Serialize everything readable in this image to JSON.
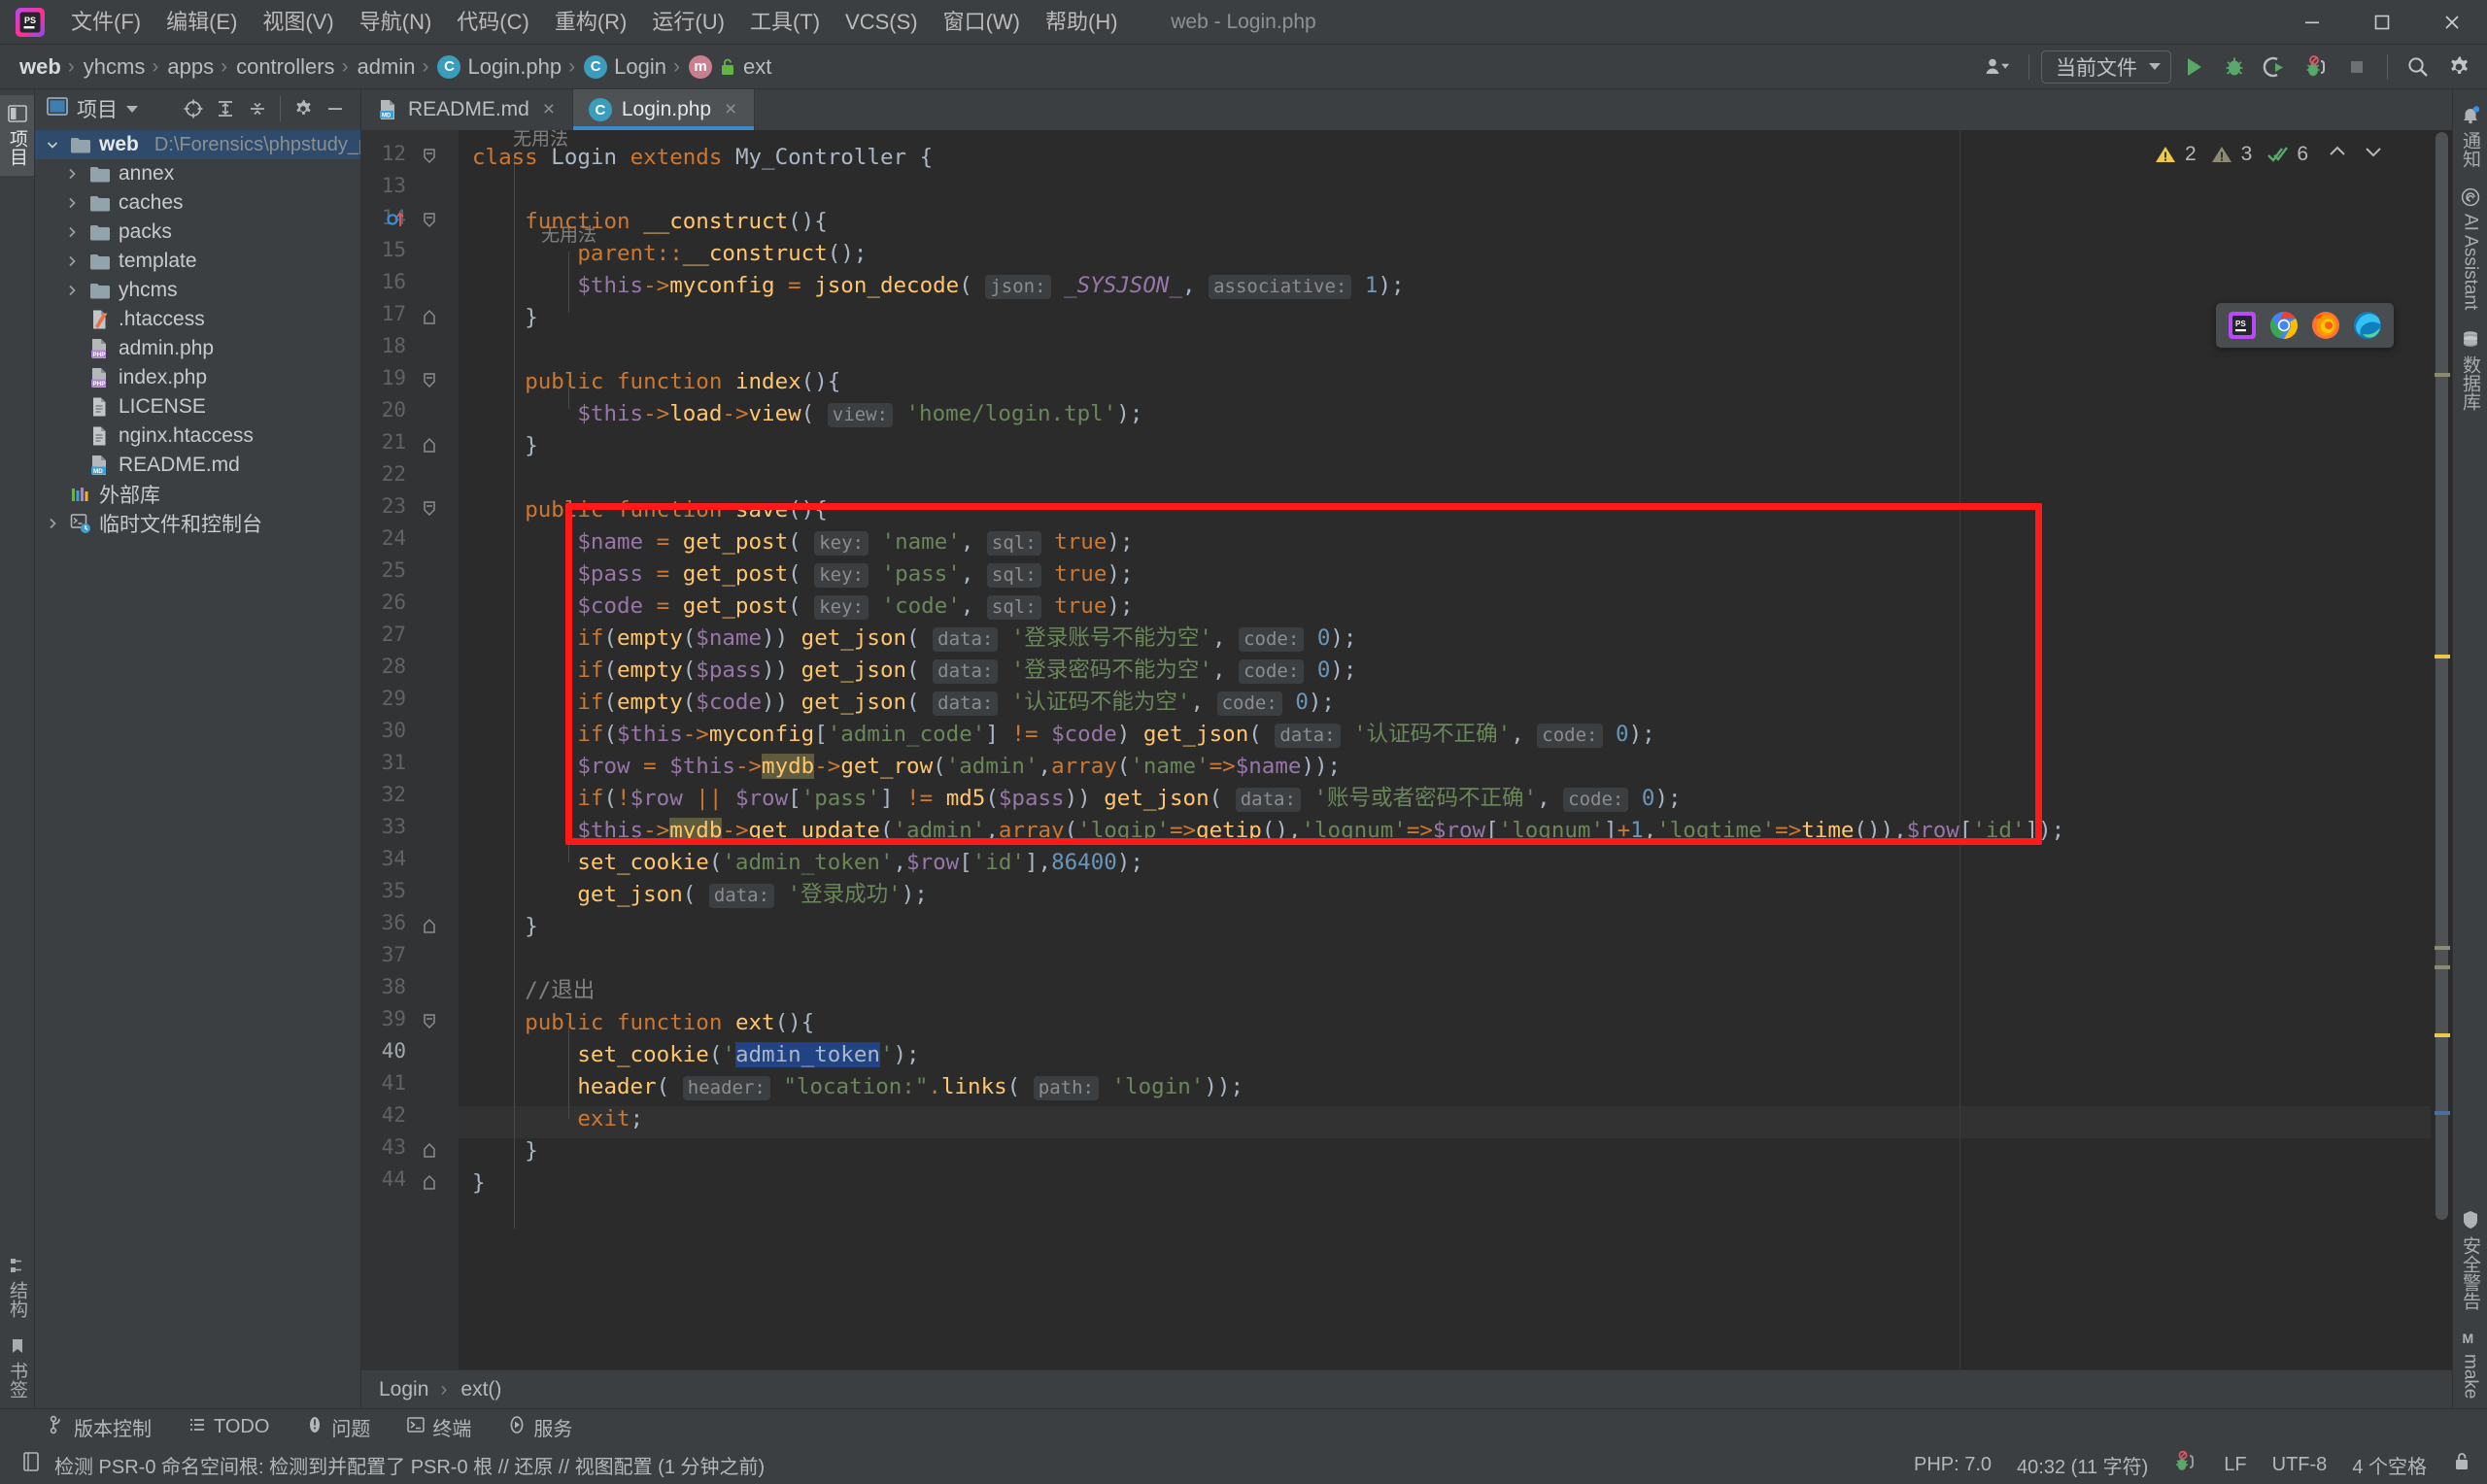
{
  "window": {
    "title": "web - Login.php",
    "controls": [
      "minimize",
      "maximize",
      "close"
    ]
  },
  "menubar": {
    "items": [
      {
        "label": "文件(F)",
        "name": "menu-file"
      },
      {
        "label": "编辑(E)",
        "name": "menu-edit"
      },
      {
        "label": "视图(V)",
        "name": "menu-view"
      },
      {
        "label": "导航(N)",
        "name": "menu-navigate"
      },
      {
        "label": "代码(C)",
        "name": "menu-code"
      },
      {
        "label": "重构(R)",
        "name": "menu-refactor"
      },
      {
        "label": "运行(U)",
        "name": "menu-run"
      },
      {
        "label": "工具(T)",
        "name": "menu-tools"
      },
      {
        "label": "VCS(S)",
        "name": "menu-vcs"
      },
      {
        "label": "窗口(W)",
        "name": "menu-window"
      },
      {
        "label": "帮助(H)",
        "name": "menu-help"
      }
    ]
  },
  "breadcrumb": {
    "items": [
      {
        "label": "web",
        "icon": "none",
        "bold": true
      },
      {
        "label": "yhcms",
        "icon": "none"
      },
      {
        "label": "apps",
        "icon": "none"
      },
      {
        "label": "controllers",
        "icon": "none"
      },
      {
        "label": "admin",
        "icon": "none"
      },
      {
        "label": "Login.php",
        "icon": "class-c-icon"
      },
      {
        "label": "Login",
        "icon": "class-c-icon"
      },
      {
        "label": "ext",
        "icon": "method-m-icon"
      }
    ],
    "separator": "›"
  },
  "toolbar": {
    "run_config": "当前文件",
    "buttons": [
      {
        "name": "user-avatar-button",
        "title": "用户"
      },
      {
        "name": "run-button",
        "title": "运行"
      },
      {
        "name": "debug-button",
        "title": "调试"
      },
      {
        "name": "run-with-coverage-button",
        "title": "运行并附加覆盖率"
      },
      {
        "name": "stop-debug-button",
        "title": "停止调试"
      },
      {
        "name": "stop-button",
        "title": "停止"
      },
      {
        "name": "search-everywhere-button",
        "title": "搜索"
      },
      {
        "name": "settings-button",
        "title": "设置"
      }
    ]
  },
  "left_rail": {
    "top": [
      {
        "label": "项目",
        "name": "sidebar-item-project",
        "active": true
      }
    ],
    "bottom": [
      {
        "label": "结构",
        "name": "sidebar-item-structure"
      },
      {
        "label": "书签",
        "name": "sidebar-item-bookmarks"
      }
    ]
  },
  "right_rail": {
    "top": [
      {
        "label": "通知",
        "name": "sidebar-item-notifications"
      },
      {
        "label": "AI Assistant",
        "name": "sidebar-item-ai-assistant"
      },
      {
        "label": "数据库",
        "name": "sidebar-item-database"
      }
    ],
    "bottom": [
      {
        "label": "安全警告",
        "name": "sidebar-item-security-warnings"
      },
      {
        "label": "make",
        "name": "sidebar-item-make"
      }
    ]
  },
  "project_panel": {
    "title": "项目",
    "tree": [
      {
        "label": "web",
        "path": "D:\\Forensics\\phpstudy_pro\\WWW\\web",
        "depth": 0,
        "icon": "folder-icon",
        "twist": "down",
        "selected": true,
        "bold": true
      },
      {
        "label": "annex",
        "depth": 1,
        "icon": "folder-icon",
        "twist": "right"
      },
      {
        "label": "caches",
        "depth": 1,
        "icon": "folder-icon",
        "twist": "right"
      },
      {
        "label": "packs",
        "depth": 1,
        "icon": "folder-icon",
        "twist": "right"
      },
      {
        "label": "template",
        "depth": 1,
        "icon": "folder-icon",
        "twist": "right"
      },
      {
        "label": "yhcms",
        "depth": 1,
        "icon": "folder-icon",
        "twist": "right"
      },
      {
        "label": ".htaccess",
        "depth": 1,
        "icon": "htaccess-icon",
        "twist": "none"
      },
      {
        "label": "admin.php",
        "depth": 1,
        "icon": "php-file-icon",
        "twist": "none"
      },
      {
        "label": "index.php",
        "depth": 1,
        "icon": "php-file-icon",
        "twist": "none"
      },
      {
        "label": "LICENSE",
        "depth": 1,
        "icon": "text-file-icon",
        "twist": "none"
      },
      {
        "label": "nginx.htaccess",
        "depth": 1,
        "icon": "text-file-icon",
        "twist": "none"
      },
      {
        "label": "README.md",
        "depth": 1,
        "icon": "markdown-file-icon",
        "twist": "none"
      },
      {
        "label": "外部库",
        "depth": 0,
        "icon": "external-libraries-icon",
        "twist": "none"
      },
      {
        "label": "临时文件和控制台",
        "depth": 0,
        "icon": "scratches-icon",
        "twist": "right"
      }
    ]
  },
  "editor_tabs": [
    {
      "label": "README.md",
      "icon": "markdown-file-icon",
      "active": false,
      "close": "×"
    },
    {
      "label": "Login.php",
      "icon": "class-c-icon",
      "active": true,
      "close": "×"
    }
  ],
  "inspection_widget": {
    "warnings": "2",
    "weak_warnings": "3",
    "typos": "6",
    "up": "⌃",
    "down": "⌄"
  },
  "browser_popup": {
    "items": [
      "phpstorm-icon",
      "chrome-icon",
      "firefox-icon",
      "edge-icon"
    ]
  },
  "editor_breadcrumb": {
    "items": [
      "Login",
      "ext()"
    ],
    "separator": "›"
  },
  "code": {
    "inlay_above_12": "无用法",
    "inlay_above_14": "无用法",
    "first_line_number": 12,
    "last_line_number": 44,
    "lines": [
      {
        "n": 12,
        "text": "class Login extends My_Controller {"
      },
      {
        "n": 13,
        "text": ""
      },
      {
        "n": 14,
        "text": "    function __construct(){"
      },
      {
        "n": 15,
        "text": "        parent::__construct();"
      },
      {
        "n": 16,
        "text": "        $this->myconfig = json_decode( json: _SYSJSON_, associative: 1);"
      },
      {
        "n": 17,
        "text": "    }"
      },
      {
        "n": 18,
        "text": ""
      },
      {
        "n": 19,
        "text": "    public function index(){"
      },
      {
        "n": 20,
        "text": "        $this->load->view( view: 'home/login.tpl');"
      },
      {
        "n": 21,
        "text": "    }"
      },
      {
        "n": 22,
        "text": ""
      },
      {
        "n": 23,
        "text": "    public function save(){"
      },
      {
        "n": 24,
        "text": "        $name = get_post( key: 'name', sql: true);"
      },
      {
        "n": 25,
        "text": "        $pass = get_post( key: 'pass', sql: true);"
      },
      {
        "n": 26,
        "text": "        $code = get_post( key: 'code', sql: true);"
      },
      {
        "n": 27,
        "text": "        if(empty($name)) get_json( data: '登录账号不能为空', code: 0);"
      },
      {
        "n": 28,
        "text": "        if(empty($pass)) get_json( data: '登录密码不能为空', code: 0);"
      },
      {
        "n": 29,
        "text": "        if(empty($code)) get_json( data: '认证码不能为空', code: 0);"
      },
      {
        "n": 30,
        "text": "        if($this->myconfig['admin_code'] != $code) get_json( data: '认证码不正确', code: 0);"
      },
      {
        "n": 31,
        "text": "        $row = $this->mydb->get_row('admin',array('name'=>$name));"
      },
      {
        "n": 32,
        "text": "        if(!$row || $row['pass'] != md5($pass)) get_json( data: '账号或者密码不正确', code: 0);"
      },
      {
        "n": 33,
        "text": "        $this->mydb->get_update('admin',array('logip'=>getip(),'lognum'=>$row['lognum']+1,'logtime'=>time()),$row['id']);"
      },
      {
        "n": 34,
        "text": "        set_cookie('admin_token',$row['id'],86400);"
      },
      {
        "n": 35,
        "text": "        get_json( data: '登录成功');"
      },
      {
        "n": 36,
        "text": "    }"
      },
      {
        "n": 37,
        "text": ""
      },
      {
        "n": 38,
        "text": "    //退出"
      },
      {
        "n": 39,
        "text": "    public function ext(){"
      },
      {
        "n": 40,
        "text": "        set_cookie('admin_token');"
      },
      {
        "n": 41,
        "text": "        header( header: \"location:\".links( path: 'login'));"
      },
      {
        "n": 42,
        "text": "        exit;"
      },
      {
        "n": 43,
        "text": "    }"
      },
      {
        "n": 44,
        "text": "}"
      }
    ],
    "selected_text": "admin_token",
    "current_line": 40
  },
  "bottom_tools": [
    {
      "label": "版本控制",
      "name": "tool-version-control",
      "icon": "branch-icon"
    },
    {
      "label": "TODO",
      "name": "tool-todo",
      "icon": "list-icon"
    },
    {
      "label": "问题",
      "name": "tool-problems",
      "icon": "exclamation-icon"
    },
    {
      "label": "终端",
      "name": "tool-terminal",
      "icon": "terminal-icon"
    },
    {
      "label": "服务",
      "name": "tool-services",
      "icon": "play-circle-icon"
    }
  ],
  "status_bar": {
    "message": "检测 PSR-0 命名空间根: 检测到并配置了 PSR-0 根 // 还原 // 视图配置 (1 分钟之前)",
    "php_version": "PHP: 7.0",
    "caret_position": "40:32 (11 字符)",
    "line_separator": "LF",
    "encoding": "UTF-8",
    "indent": "4 个空格",
    "lock": "lock-icon",
    "debug_badge": "stop-debug-icon"
  },
  "colors": {
    "chrome": "#3c3f41",
    "editor_bg": "#2b2b2b",
    "gutter_bg": "#313335",
    "accent_blue": "#3d88c9",
    "selection_blue": "#2e4b6b",
    "annotation_red": "#ff1a1a",
    "keyword_orange": "#cc7832",
    "string_green": "#6a8759",
    "function_yellow": "#ffc66d",
    "variable_purple": "#9876aa",
    "number_blue": "#6897bb"
  }
}
